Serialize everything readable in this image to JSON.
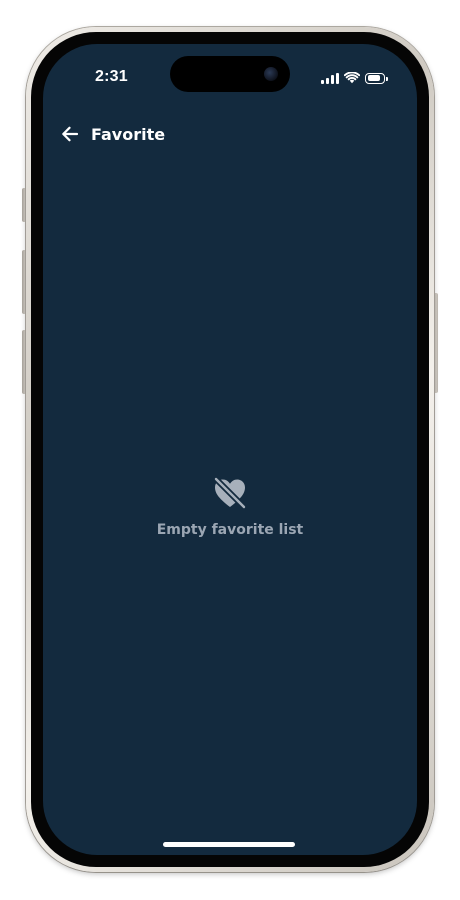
{
  "status_bar": {
    "time": "2:31",
    "signal_icon": "signal-bars-icon",
    "wifi_icon": "wifi-icon",
    "battery_icon": "battery-icon",
    "battery_level": 0.85
  },
  "header": {
    "back_icon": "arrow-left-icon",
    "title": "Favorite"
  },
  "empty_state": {
    "icon": "heart-off-icon",
    "message": "Empty favorite list"
  },
  "colors": {
    "screen_background": "#132a3e",
    "primary_text": "#ffffff",
    "muted_text": "#9ba6b3",
    "icon_muted": "#a7b0bb"
  }
}
